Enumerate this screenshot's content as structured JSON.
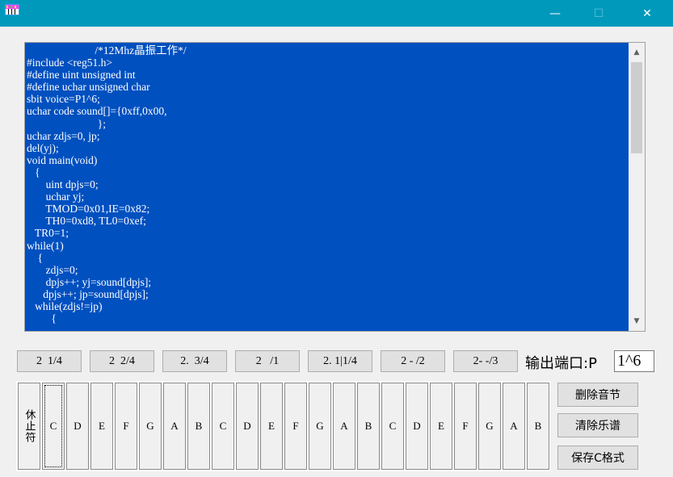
{
  "window": {
    "icon": "piano-app-icon",
    "controls": {
      "minimize": "—",
      "maximize": "☐",
      "close": "✕"
    }
  },
  "editor": {
    "code": "                         /*12Mhz晶振工作*/\n#include <reg51.h>\n#define uint unsigned int\n#define uchar unsigned char\nsbit voice=P1^6;\nuchar code sound[]={0xff,0x00,\n                          };\nuchar zdjs=0, jp;\ndel(yj);\nvoid main(void)\n   {\n       uint dpjs=0;\n       uchar yj;\n       TMOD=0x01,IE=0x82;\n       TH0=0xd8, TL0=0xef;\n   TR0=1;\nwhile(1)\n    {\n       zdjs=0;\n       dpjs++; yj=sound[dpjs];\n      dpjs++; jp=sound[dpjs];\n   while(zdjs!=jp)\n         {",
    "scroll_up": "▲",
    "scroll_down": "▼"
  },
  "durations": [
    "2  1/4",
    "2  2/4",
    "2.  3/4",
    "2   /1",
    "2. 1|1/4",
    "2 - /2",
    "2- -/3"
  ],
  "port": {
    "label": "输出端口:P",
    "value": "1^6"
  },
  "rest_key": "休止符",
  "keys": [
    "C",
    "D",
    "E",
    "F",
    "G",
    "A",
    "B",
    "C",
    "D",
    "E",
    "F",
    "G",
    "A",
    "B",
    "C",
    "D",
    "E",
    "F",
    "G",
    "A",
    "B"
  ],
  "side_buttons": {
    "delete_note": "删除音节",
    "clear_score": "清除乐谱",
    "save_c": "保存C格式"
  }
}
